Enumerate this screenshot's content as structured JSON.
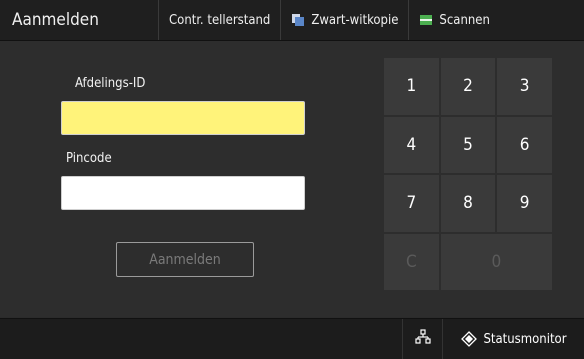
{
  "header": {
    "title": "Aanmelden",
    "tabs": [
      {
        "label": "Contr. tellerstand",
        "icon": ""
      },
      {
        "label": "Zwart-witkopie",
        "icon": "copy-icon"
      },
      {
        "label": "Scannen",
        "icon": "scan-icon"
      }
    ]
  },
  "form": {
    "dept_label": "Afdelings-ID",
    "dept_value": "",
    "pin_label": "Pincode",
    "pin_value": "",
    "login_button": "Aanmelden"
  },
  "keypad": {
    "keys": [
      "1",
      "2",
      "3",
      "4",
      "5",
      "6",
      "7",
      "8",
      "9"
    ],
    "clear": "C",
    "zero": "0"
  },
  "footer": {
    "network_icon": "network-icon",
    "status_label": "Statusmonitor",
    "status_icon": "status-monitor-icon"
  },
  "colors": {
    "active_field": "#fff37a",
    "background": "#2d2d2d",
    "bar": "#1f1f1f"
  }
}
